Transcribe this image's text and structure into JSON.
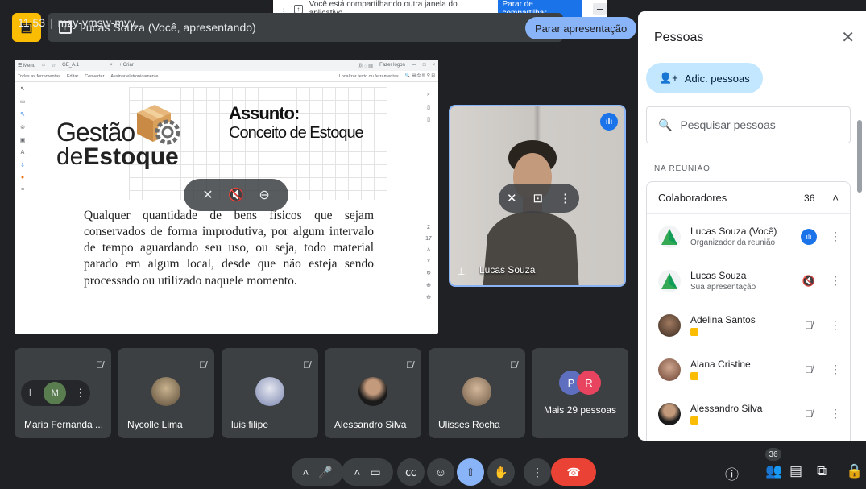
{
  "share_banner": {
    "text": "Você está compartilhando outra janela do aplicativo.",
    "stop_label": "Parar de compartilhar"
  },
  "presenting": {
    "label": "Lucas Souza (Você, apresentando)",
    "stop_label": "Parar apresentação"
  },
  "shared_window": {
    "tabs": [
      "☰ Menu",
      "⌂",
      "☆",
      "GE_A.1",
      "×",
      "+ Criar"
    ],
    "tab_right": [
      "Fazer logon",
      "—",
      "□",
      "×"
    ],
    "toolbar_items": [
      "Todas as ferramentas",
      "Editar",
      "Converter",
      "Assinar eletronicamente"
    ],
    "toolbar_search": "Localizar texto ou ferramentas",
    "logo_line1": "Gestão",
    "logo_line2_a": "de",
    "logo_line2_b": "Estoque",
    "subject_title": "Assunto:",
    "subject_text": "Conceito de Estoque",
    "body": "Qualquer quantidade de bens físicos que sejam conservados de forma improdutiva, por algum intervalo de tempo aguardando seu uso, ou seja, todo material parado em algum local, desde que não esteja sendo processado ou utilizado naquele momento.",
    "page_indicator": [
      "2",
      "17"
    ]
  },
  "self_tile": {
    "name": "Lucas Souza"
  },
  "participants": [
    {
      "name": "Maria Fernanda ...",
      "initial": "M"
    },
    {
      "name": "Nycolle Lima"
    },
    {
      "name": "luis filipe"
    },
    {
      "name": "Alessandro Silva"
    },
    {
      "name": "Ulisses Rocha"
    }
  ],
  "more_tile": {
    "label": "Mais 29 pessoas",
    "initials": [
      "P",
      "R"
    ],
    "colors": [
      "#5f6fbf",
      "#e8435f"
    ]
  },
  "meeting": {
    "time": "11:53",
    "code": "mzy-ymsw-myv"
  },
  "people_count_badge": "36",
  "panel": {
    "title": "Pessoas",
    "add_label": "Adic. pessoas",
    "search_placeholder": "Pesquisar pessoas",
    "section": "NA REUNIÃO",
    "group_label": "Colaboradores",
    "group_count": "36",
    "people": [
      {
        "name": "Lucas Souza (Você)",
        "sub": "Organizador da reunião",
        "status": "speaking"
      },
      {
        "name": "Lucas Souza",
        "sub": "Sua apresentação",
        "status": "audio-off"
      },
      {
        "name": "Adelina Santos",
        "sub": "",
        "status": "mic-off"
      },
      {
        "name": "Alana Cristine",
        "sub": "",
        "status": "mic-off"
      },
      {
        "name": "Alessandro Silva",
        "sub": "",
        "status": "mic-off"
      }
    ]
  },
  "colors": {
    "bg": "#202124",
    "accent": "#8ab4f8",
    "end_call": "#ea4335",
    "panel": "#ffffff",
    "add_btn": "#c2e7ff"
  }
}
